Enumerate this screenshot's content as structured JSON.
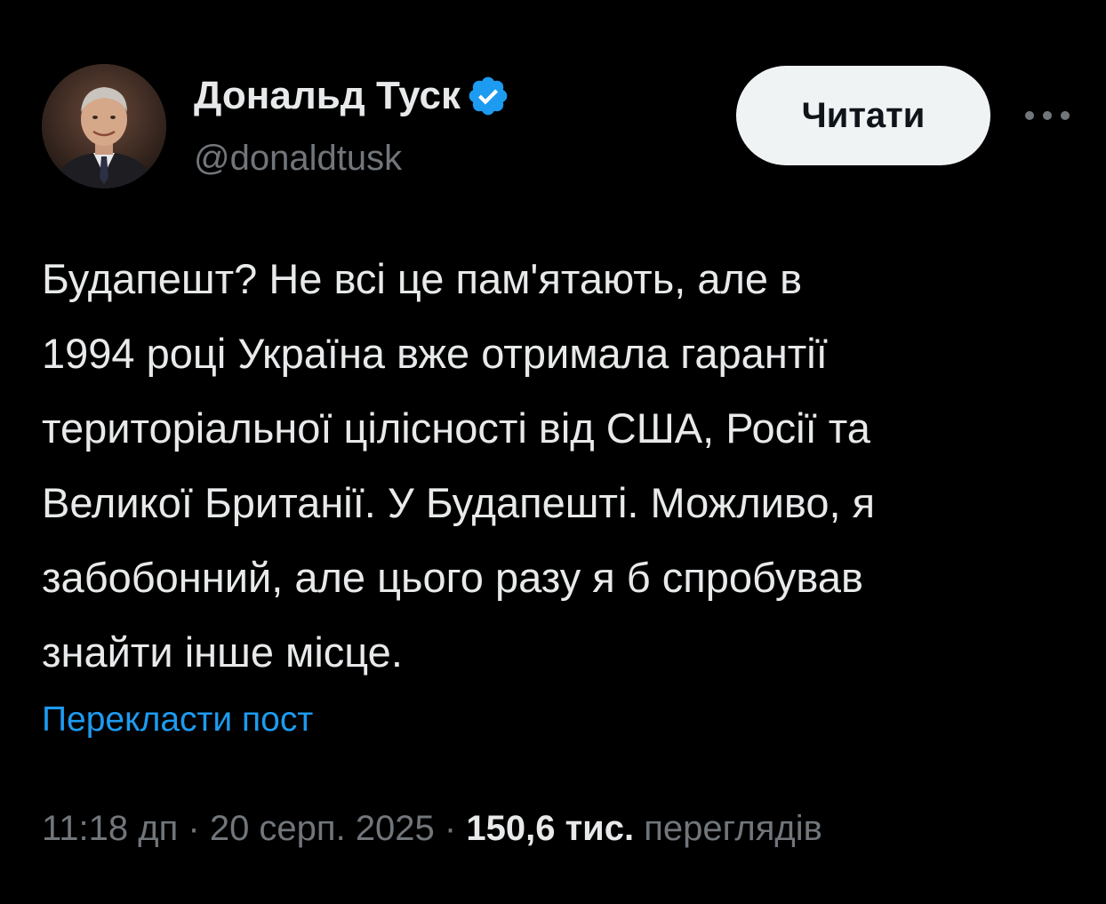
{
  "author": {
    "display_name": "Дональд Туск",
    "handle": "@donaldtusk",
    "verified_icon": "verified-badge-icon",
    "avatar_icon": "avatar-photo"
  },
  "actions": {
    "follow_label": "Читати",
    "more_icon": "more-options-icon"
  },
  "post": {
    "text": "Будапешт? Не всі це пам'ятають, але в\n1994 році Україна вже отримала гарантії\nтериторіальної цілісності від США, Росії та\nВеликої Британії. У Будапешті. Можливо, я\nзабобонний, але цього разу я б спробував\nзнайти інше місце.",
    "translate_label": "Перекласти пост"
  },
  "meta": {
    "time": "11:18 дп",
    "separator": "·",
    "date": "20 серп. 2025",
    "views_count": "150,6 тис.",
    "views_label": "переглядів"
  },
  "colors": {
    "background": "#000000",
    "text_primary": "#e7e9ea",
    "text_secondary": "#71767b",
    "link": "#1d9bf0",
    "verified": "#1d9bf0",
    "button_bg": "#eff3f4",
    "button_text": "#0f1419"
  }
}
